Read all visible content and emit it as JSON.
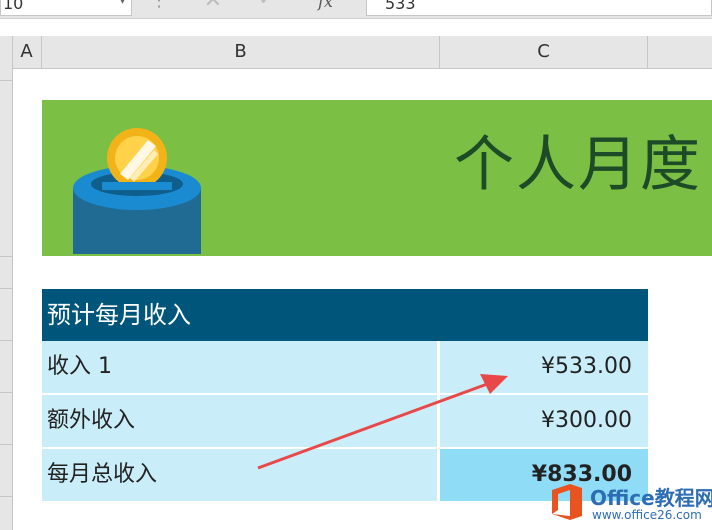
{
  "formula_bar": {
    "name_box": "10",
    "formula_value": "533",
    "fx_label": "fx",
    "cancel_glyph": "✕",
    "enter_glyph": "✓"
  },
  "columns": [
    "A",
    "B",
    "C"
  ],
  "banner": {
    "title": "个人月度",
    "background_color": "#7cbf45",
    "title_color": "#1d4a27"
  },
  "income_table": {
    "header": "预计每月收入",
    "header_color": "#00567a",
    "rows": [
      {
        "label": "收入 1",
        "value": "¥533.00"
      },
      {
        "label": "额外收入",
        "value": "¥300.00"
      },
      {
        "label": "每月总收入",
        "value": "¥833.00"
      }
    ]
  },
  "watermark": {
    "brand": "Office教程网",
    "url": "www.office26.com"
  }
}
